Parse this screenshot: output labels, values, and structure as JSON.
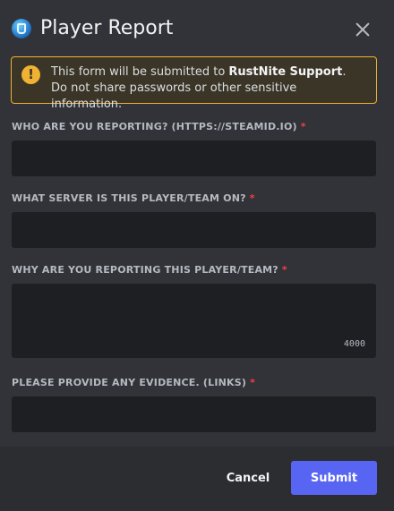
{
  "header": {
    "title": "Player Report",
    "icon": "app-icon",
    "close_icon": "close-icon"
  },
  "warning": {
    "icon": "exclamation-icon",
    "glyph": "!",
    "text_prefix": "This form will be submitted to ",
    "org": "RustNite Support",
    "text_suffix": ". Do not share passwords or other sensitive information."
  },
  "fields": [
    {
      "label": "WHO ARE YOU REPORTING? (HTTPS://STEAMID.IO)",
      "required": "*",
      "value": ""
    },
    {
      "label": "WHAT SERVER IS THIS PLAYER/TEAM ON?",
      "required": "*",
      "value": ""
    },
    {
      "label": "WHY ARE YOU REPORTING THIS PLAYER/TEAM?",
      "required": "*",
      "value": "",
      "counter": "4000"
    },
    {
      "label": "PLEASE PROVIDE ANY EVIDENCE. (LINKS)",
      "required": "*",
      "value": ""
    }
  ],
  "footer": {
    "cancel_label": "Cancel",
    "submit_label": "Submit"
  },
  "colors": {
    "accent": "#5865f2",
    "warning": "#f0b232",
    "required": "#f23f43",
    "background": "#313338"
  }
}
